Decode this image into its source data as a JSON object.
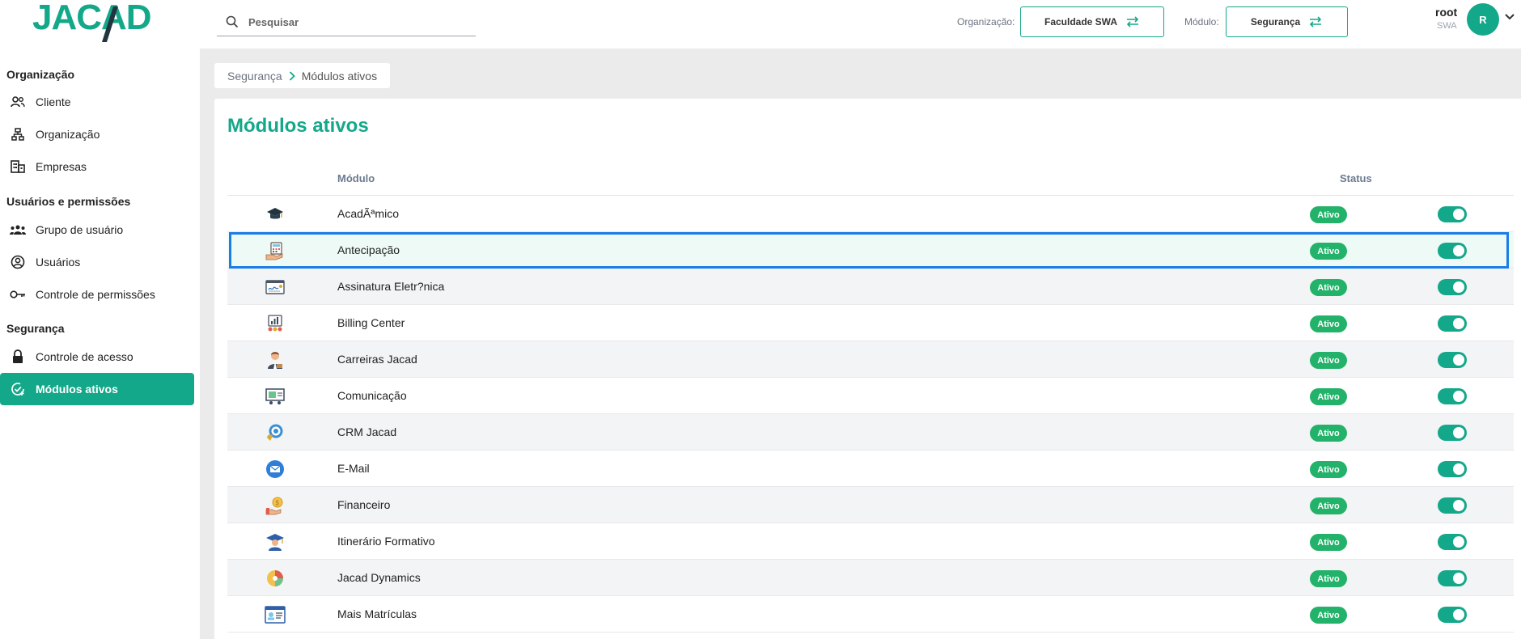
{
  "logo": {
    "text": "JACAD"
  },
  "search": {
    "placeholder": "Pesquisar"
  },
  "header": {
    "org_label": "Organização:",
    "org_value": "Faculdade SWA",
    "module_label": "Módulo:",
    "module_value": "Segurança",
    "user_name": "root",
    "user_org": "SWA",
    "avatar_initial": "R"
  },
  "sidebar": {
    "groups": [
      {
        "title": "Organização",
        "items": [
          {
            "label": "Cliente",
            "icon": "users-icon"
          },
          {
            "label": "Organização",
            "icon": "org-chart-icon"
          },
          {
            "label": "Empresas",
            "icon": "building-icon"
          }
        ]
      },
      {
        "title": "Usuários e permissões",
        "items": [
          {
            "label": "Grupo de usuário",
            "icon": "user-group-icon"
          },
          {
            "label": "Usuários",
            "icon": "user-circle-icon"
          },
          {
            "label": "Controle de permissões",
            "icon": "key-icon"
          }
        ]
      },
      {
        "title": "Segurança",
        "items": [
          {
            "label": "Controle de acesso",
            "icon": "lock-icon"
          },
          {
            "label": "Módulos ativos",
            "icon": "check-circle-icon",
            "active": true
          }
        ]
      }
    ]
  },
  "breadcrumb": {
    "parent": "Segurança",
    "current": "Módulos ativos"
  },
  "page": {
    "title": "Módulos ativos"
  },
  "table": {
    "col_module": "Módulo",
    "col_status": "Status",
    "rows": [
      {
        "name": "AcadÃªmico",
        "status": "Ativo",
        "enabled": true,
        "icon": "graduation-cap-icon"
      },
      {
        "name": "Antecipação",
        "status": "Ativo",
        "enabled": true,
        "icon": "calculator-hand-icon",
        "selected": true
      },
      {
        "name": "Assinatura Eletr?nica",
        "status": "Ativo",
        "enabled": true,
        "icon": "signature-document-icon"
      },
      {
        "name": "Billing Center",
        "status": "Ativo",
        "enabled": true,
        "icon": "billing-chart-icon"
      },
      {
        "name": "Carreiras Jacad",
        "status": "Ativo",
        "enabled": true,
        "icon": "professional-icon"
      },
      {
        "name": "Comunicação",
        "status": "Ativo",
        "enabled": true,
        "icon": "presentation-icon"
      },
      {
        "name": "CRM Jacad",
        "status": "Ativo",
        "enabled": true,
        "icon": "crm-chat-icon"
      },
      {
        "name": "E-Mail",
        "status": "Ativo",
        "enabled": true,
        "icon": "email-icon"
      },
      {
        "name": "Financeiro",
        "status": "Ativo",
        "enabled": true,
        "icon": "coin-hand-icon"
      },
      {
        "name": "Itinerário Formativo",
        "status": "Ativo",
        "enabled": true,
        "icon": "student-icon"
      },
      {
        "name": "Jacad Dynamics",
        "status": "Ativo",
        "enabled": true,
        "icon": "pie-chart-icon"
      },
      {
        "name": "Mais Matrículas",
        "status": "Ativo",
        "enabled": true,
        "icon": "id-card-icon"
      }
    ]
  },
  "colors": {
    "accent": "#14a88a",
    "status_green": "#23b26a",
    "selection_border": "#1b7ee6"
  }
}
